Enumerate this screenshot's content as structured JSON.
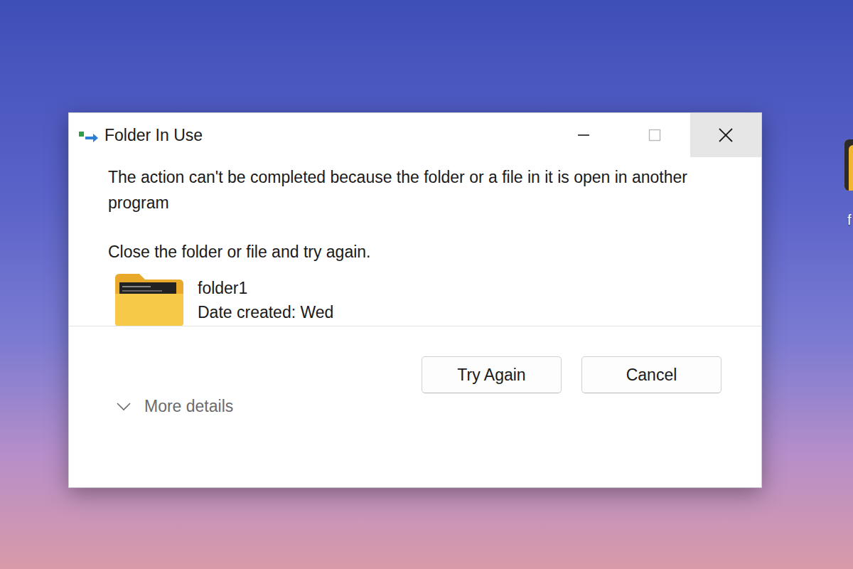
{
  "window": {
    "title": "Folder In Use"
  },
  "controls": [
    {
      "kind": "minimize",
      "disabled": false,
      "hovered": false
    },
    {
      "kind": "maximize",
      "disabled": true,
      "hovered": false
    },
    {
      "kind": "close",
      "disabled": false,
      "hovered": true
    }
  ],
  "message": "The action can't be completed because the folder or a file in it is open in another program",
  "instruction": "Close the folder or file and try again.",
  "item": {
    "name": "folder1",
    "detail": "Date created: Wed"
  },
  "buttons": [
    {
      "label": "Try Again",
      "selected": false
    },
    {
      "label": "Cancel",
      "selected": false
    }
  ],
  "details": {
    "label": "More details",
    "expanded": false
  },
  "desktop_icons": [
    {
      "label": "f"
    }
  ]
}
